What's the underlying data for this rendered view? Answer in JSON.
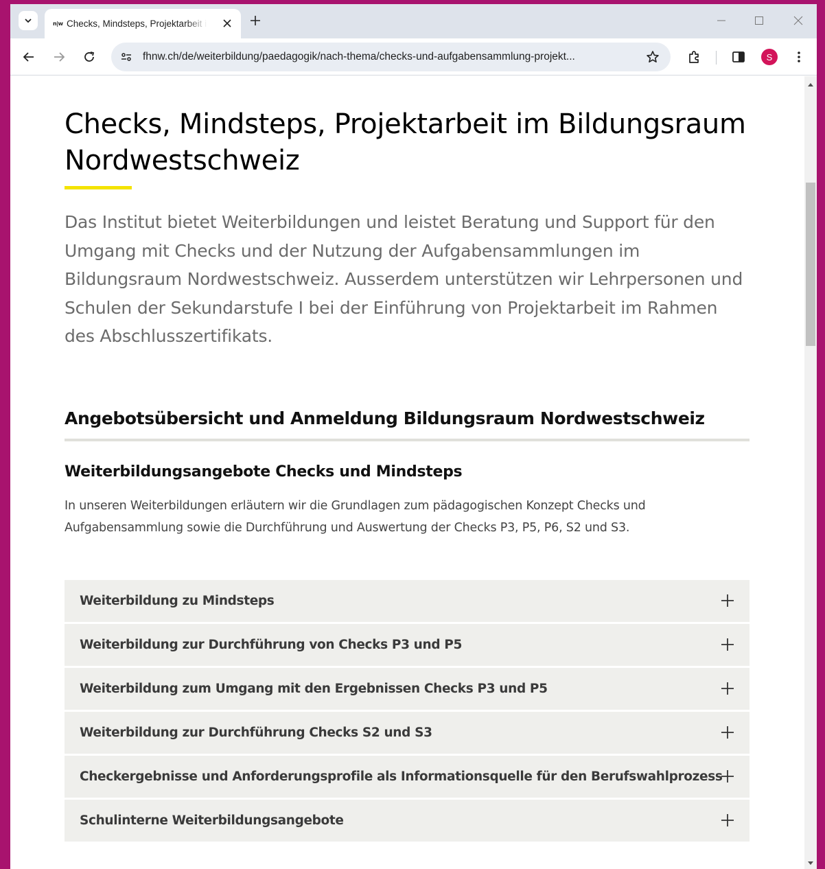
{
  "browser": {
    "tab": {
      "favicon": "n|w",
      "title": "Checks, Mindsteps, Projektarbeit im Bildungsraum Nordwestschweiz"
    },
    "url": "fhnw.ch/de/weiterbildung/paedagogik/nach-thema/checks-und-aufgabensammlung-projekt...",
    "profile_initial": "S",
    "icons": [
      "chevron-down-icon",
      "close-icon",
      "plus-icon",
      "minimize-icon",
      "maximize-icon",
      "back-icon",
      "forward-icon",
      "reload-icon",
      "site-info-icon",
      "star-icon",
      "extensions-icon",
      "side-panel-icon",
      "more-icon"
    ]
  },
  "page": {
    "title": "Checks, Mindsteps, Projektarbeit im Bildungsraum Nordwestschweiz",
    "lead": "Das Institut bietet Weiterbildungen und leistet Beratung und Support für den Umgang mit Checks und der Nutzung der Aufgabensammlungen im Bildungsraum Nordwestschweiz. Ausserdem unterstützen wir Lehrpersonen und Schulen der Sekundarstufe I bei der Einführung von Projektarbeit im Rahmen des Abschlusszertifikats.",
    "section_heading": "Angebotsübersicht und Anmeldung Bildungsraum Nordwestschweiz",
    "subheading": "Weiterbildungsangebote Checks und Mindsteps",
    "description": "In unseren Weiterbildungen erläutern wir die Grundlagen zum pädagogischen Konzept Checks und Aufgabensammlung sowie die Durchführung und Auswertung der Checks P3, P5, P6, S2 und S3.",
    "accordion": [
      {
        "label": "Weiterbildung zu Mindsteps"
      },
      {
        "label": "Weiterbildung zur Durchführung von Checks P3 und P5"
      },
      {
        "label": "Weiterbildung zum Umgang mit den Ergebnissen Checks P3 und P5"
      },
      {
        "label": "Weiterbildung zur Durchführung Checks S2 und S3"
      },
      {
        "label": "Checkergebnisse und Anforderungsprofile als Informationsquelle für den Berufswahlprozess"
      },
      {
        "label": "Schulinterne Weiterbildungsangebote"
      }
    ]
  },
  "colors": {
    "frame": "#a8136e",
    "accent_yellow": "#f4e300",
    "accordion_bg": "#efefec",
    "avatar": "#d3145a"
  }
}
